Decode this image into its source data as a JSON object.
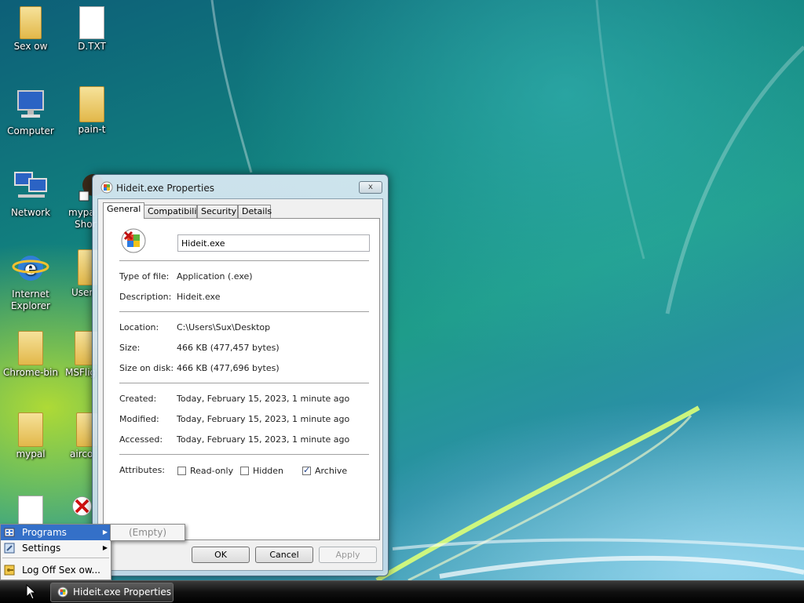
{
  "desktop": {
    "icons": [
      {
        "label": "Sex ow",
        "icon": "folder-icon"
      },
      {
        "label": "D.TXT",
        "icon": "text-file-icon"
      },
      {
        "label": "Computer",
        "icon": "computer-icon"
      },
      {
        "label": "pain-t",
        "icon": "folder-icon"
      },
      {
        "label": "Network",
        "icon": "network-icon"
      },
      {
        "label": "mypa",
        "label2": "Shor",
        "icon": "shortcut-icon"
      },
      {
        "label": "Internet",
        "label2": "Explorer",
        "icon": "internet-explorer-icon"
      },
      {
        "label": "User",
        "icon": "folder-icon"
      },
      {
        "label": "Chrome-bin",
        "icon": "folder-icon"
      },
      {
        "label": "MSFlig",
        "icon": "folder-icon"
      },
      {
        "label": "mypal",
        "icon": "folder-icon"
      },
      {
        "label": "airco",
        "icon": "folder-icon"
      }
    ]
  },
  "dialog": {
    "title": "Hideit.exe Properties",
    "close_label": "x",
    "tabs": [
      {
        "label": "General"
      },
      {
        "label": "Compatibility"
      },
      {
        "label": "Security"
      },
      {
        "label": "Details"
      }
    ],
    "file_name": "Hideit.exe",
    "rows": {
      "type": {
        "label": "Type of file:",
        "value": "Application (.exe)"
      },
      "description": {
        "label": "Description:",
        "value": "Hideit.exe"
      },
      "location": {
        "label": "Location:",
        "value": "C:\\Users\\Sux\\Desktop"
      },
      "size": {
        "label": "Size:",
        "value": "466 KB (477,457 bytes)"
      },
      "size_on_disk": {
        "label": "Size on disk:",
        "value": "466 KB (477,696 bytes)"
      },
      "created": {
        "label": "Created:",
        "value": "Today, February 15, 2023, 1 minute ago"
      },
      "modified": {
        "label": "Modified:",
        "value": "Today, February 15, 2023, 1 minute ago"
      },
      "accessed": {
        "label": "Accessed:",
        "value": "Today, February 15, 2023, 1 minute ago"
      }
    },
    "attributes": {
      "label": "Attributes:",
      "read_only": {
        "label": "Read-only",
        "checked": false
      },
      "hidden": {
        "label": "Hidden",
        "checked": false
      },
      "archive": {
        "label": "Archive",
        "checked": true
      }
    },
    "buttons": {
      "ok": "OK",
      "cancel": "Cancel",
      "apply": "Apply"
    }
  },
  "start_menu": {
    "items": [
      {
        "label": "Programs",
        "icon": "programs-icon"
      },
      {
        "label": "Settings",
        "icon": "settings-icon"
      },
      {
        "label": "Log Off Sex ow...",
        "icon": "log-off-icon"
      }
    ],
    "submenu_empty": "(Empty)"
  },
  "taskbar": {
    "task_label": "Hideit.exe Properties"
  },
  "colors": {
    "menu_highlight": "#3470c8",
    "taskbar": "#101010"
  }
}
